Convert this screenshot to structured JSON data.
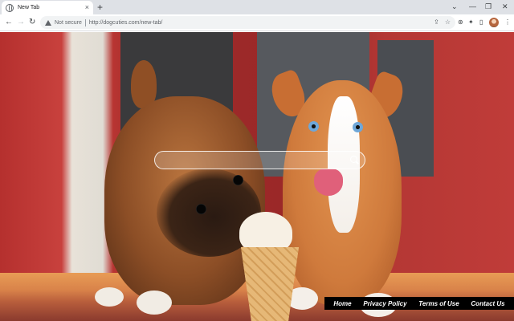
{
  "tab": {
    "title": "New Tab",
    "close": "×"
  },
  "tabstrip": {
    "new_tab": "+",
    "chevron": "⌄",
    "minimize": "—",
    "restore": "❐",
    "close": "✕"
  },
  "toolbar": {
    "back": "←",
    "forward": "→",
    "reload": "↻",
    "security_label": "Not secure",
    "url": "http://dogcuties.com/new-tab/",
    "share": "⇪",
    "bookmark": "☆",
    "extension": "⊛",
    "puzzle": "✦",
    "sidebar": "▯",
    "menu": "⋮"
  },
  "search": {
    "placeholder": ""
  },
  "footer": {
    "links": [
      "Home",
      "Privacy Policy",
      "Terms of Use",
      "Contact Us"
    ]
  }
}
